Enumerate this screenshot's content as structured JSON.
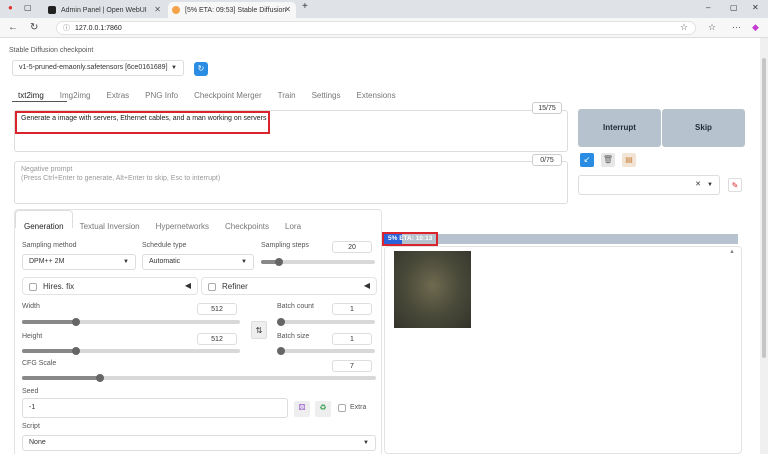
{
  "browser": {
    "tabs": [
      {
        "label": "Admin Panel | Open WebUI",
        "active": false
      },
      {
        "label": "[5% ETA: 09:53] Stable Diffusion",
        "active": true
      }
    ],
    "url": "127.0.0.1:7860",
    "window_controls": [
      "–",
      "▢",
      "✕"
    ]
  },
  "checkpoint": {
    "label": "Stable Diffusion checkpoint",
    "value": "v1-5-pruned-emaonly.safetensors [6ce0161689]"
  },
  "main_tabs": [
    "txt2img",
    "Img2img",
    "Extras",
    "PNG Info",
    "Checkpoint Merger",
    "Train",
    "Settings",
    "Extensions"
  ],
  "prompt": {
    "value": "Generate a image with servers, Ethernet cables, and a man working on servers",
    "counter": "15/75"
  },
  "negative_prompt": {
    "label": "Negative prompt",
    "placeholder": "(Press Ctrl+Enter to generate, Alt+Enter to skip, Esc to interrupt)",
    "counter": "0/75"
  },
  "actions": {
    "interrupt": "Interrupt",
    "skip": "Skip"
  },
  "sub_tabs": [
    "Generation",
    "Textual Inversion",
    "Hypernetworks",
    "Checkpoints",
    "Lora"
  ],
  "generation": {
    "sampling_method_label": "Sampling method",
    "sampling_method": "DPM++ 2M",
    "schedule_type_label": "Schedule type",
    "schedule_type": "Automatic",
    "sampling_steps_label": "Sampling steps",
    "sampling_steps": "20",
    "hires_fix": "Hires. fix",
    "refiner": "Refiner",
    "width_label": "Width",
    "width": "512",
    "height_label": "Height",
    "height": "512",
    "batch_count_label": "Batch count",
    "batch_count": "1",
    "batch_size_label": "Batch size",
    "batch_size": "1",
    "cfg_label": "CFG Scale",
    "cfg": "7",
    "seed_label": "Seed",
    "seed": "-1",
    "extra_label": "Extra",
    "script_label": "Script",
    "script": "None"
  },
  "progress": {
    "text": "5% ETA: 10:13",
    "fraction": 0.05
  },
  "colors": {
    "accent": "#2a8de3",
    "highlight": "#d9232d",
    "button": "#b6c2cd"
  }
}
